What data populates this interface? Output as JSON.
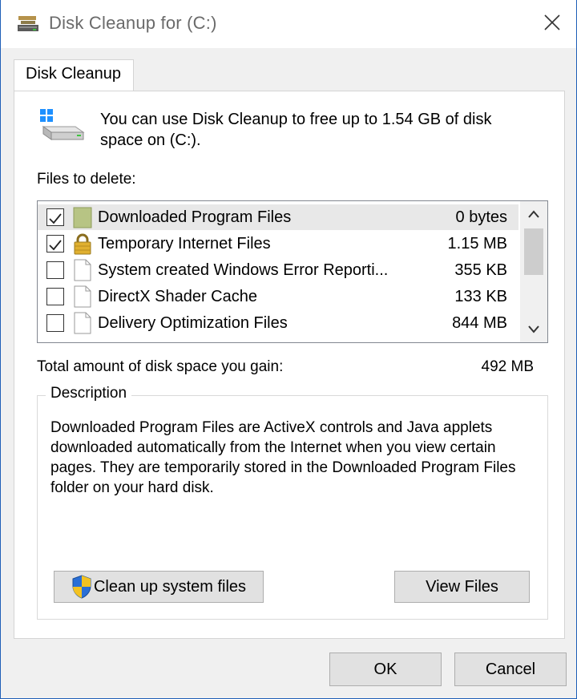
{
  "window": {
    "title": "Disk Cleanup for  (C:)"
  },
  "tabs": [
    {
      "label": "Disk Cleanup"
    }
  ],
  "intro": {
    "text": "You can use Disk Cleanup to free up to 1.54 GB of disk space on  (C:)."
  },
  "files": {
    "label": "Files to delete:",
    "items": [
      {
        "name": "Downloaded Program Files",
        "size": "0 bytes",
        "checked": true,
        "icon": "folder-icon"
      },
      {
        "name": "Temporary Internet Files",
        "size": "1.15 MB",
        "checked": true,
        "icon": "lock-icon"
      },
      {
        "name": "System created Windows Error Reporti...",
        "size": "355 KB",
        "checked": false,
        "icon": "document-icon"
      },
      {
        "name": "DirectX Shader Cache",
        "size": "133 KB",
        "checked": false,
        "icon": "document-icon"
      },
      {
        "name": "Delivery Optimization Files",
        "size": "844 MB",
        "checked": false,
        "icon": "document-icon"
      }
    ]
  },
  "total": {
    "label": "Total amount of disk space you gain:",
    "value": "492 MB"
  },
  "description": {
    "legend": "Description",
    "text": "Downloaded Program Files are ActiveX controls and Java applets downloaded automatically from the Internet when you view certain pages. They are temporarily stored in the Downloaded Program Files folder on your hard disk."
  },
  "buttons": {
    "cleanup_system": "Clean up system files",
    "view_files": "View Files",
    "ok": "OK",
    "cancel": "Cancel"
  },
  "colors": {
    "accent_border": "#1f5fb8",
    "selected_row": "#e8e8e8",
    "button_face": "#e1e1e1"
  }
}
